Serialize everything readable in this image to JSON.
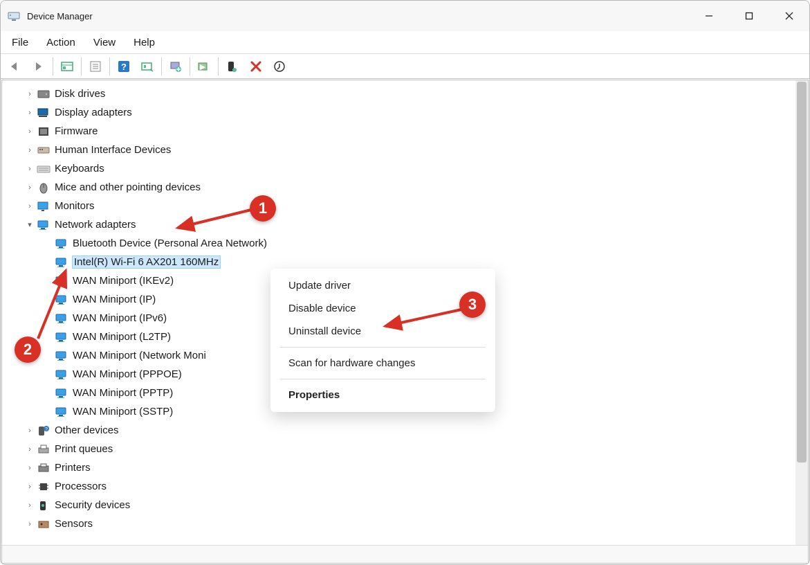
{
  "window": {
    "title": "Device Manager"
  },
  "menu": {
    "file": "File",
    "action": "Action",
    "view": "View",
    "help": "Help"
  },
  "tree": {
    "categories": [
      {
        "expanded": false,
        "icon": "disk",
        "label": "Disk drives"
      },
      {
        "expanded": false,
        "icon": "display",
        "label": "Display adapters"
      },
      {
        "expanded": false,
        "icon": "firmware",
        "label": "Firmware"
      },
      {
        "expanded": false,
        "icon": "hid",
        "label": "Human Interface Devices"
      },
      {
        "expanded": false,
        "icon": "keyboard",
        "label": "Keyboards"
      },
      {
        "expanded": false,
        "icon": "mouse",
        "label": "Mice and other pointing devices"
      },
      {
        "expanded": false,
        "icon": "monitor",
        "label": "Monitors"
      },
      {
        "expanded": true,
        "icon": "network",
        "label": "Network adapters",
        "children": [
          {
            "label": "Bluetooth Device (Personal Area Network)",
            "selected": false
          },
          {
            "label": "Intel(R) Wi-Fi 6 AX201 160MHz",
            "selected": true
          },
          {
            "label": "WAN Miniport (IKEv2)",
            "selected": false
          },
          {
            "label": "WAN Miniport (IP)",
            "selected": false
          },
          {
            "label": "WAN Miniport (IPv6)",
            "selected": false
          },
          {
            "label": "WAN Miniport (L2TP)",
            "selected": false
          },
          {
            "label": "WAN Miniport (Network Moni",
            "selected": false
          },
          {
            "label": "WAN Miniport (PPPOE)",
            "selected": false
          },
          {
            "label": "WAN Miniport (PPTP)",
            "selected": false
          },
          {
            "label": "WAN Miniport (SSTP)",
            "selected": false
          }
        ]
      },
      {
        "expanded": false,
        "icon": "other",
        "label": "Other devices"
      },
      {
        "expanded": false,
        "icon": "printq",
        "label": "Print queues"
      },
      {
        "expanded": false,
        "icon": "printer",
        "label": "Printers"
      },
      {
        "expanded": false,
        "icon": "cpu",
        "label": "Processors"
      },
      {
        "expanded": false,
        "icon": "security",
        "label": "Security devices"
      },
      {
        "expanded": false,
        "icon": "sensor",
        "label": "Sensors"
      }
    ]
  },
  "context_menu": {
    "update": "Update driver",
    "disable": "Disable device",
    "uninstall": "Uninstall device",
    "scan": "Scan for hardware changes",
    "properties": "Properties"
  },
  "annotations": {
    "b1": "1",
    "b2": "2",
    "b3": "3"
  }
}
